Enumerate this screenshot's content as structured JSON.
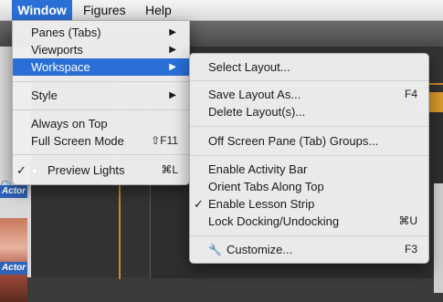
{
  "menubar": {
    "items": [
      {
        "label": "Window"
      },
      {
        "label": "Figures"
      },
      {
        "label": "Help"
      }
    ]
  },
  "background": {
    "actor_label_1": "Actor",
    "actor_label_2": "Actor",
    "accent_color": "#d99a2b"
  },
  "window_menu": {
    "items": [
      {
        "label": "Panes (Tabs)",
        "submenu": true
      },
      {
        "label": "Viewports",
        "submenu": true
      },
      {
        "label": "Workspace",
        "submenu": true,
        "highlighted": true
      },
      {
        "label": "Style",
        "submenu": true
      },
      {
        "label": "Always on Top"
      },
      {
        "label": "Full Screen Mode",
        "shortcut": "⇧F11"
      },
      {
        "label": "Preview Lights",
        "shortcut": "⌘L",
        "checked": true,
        "icon": "light-bulb-icon"
      }
    ]
  },
  "workspace_menu": {
    "items": [
      {
        "label": "Select Layout..."
      },
      {
        "label": "Save Layout As...",
        "shortcut": "F4"
      },
      {
        "label": "Delete Layout(s)..."
      },
      {
        "label": "Off Screen Pane (Tab) Groups..."
      },
      {
        "label": "Enable Activity Bar"
      },
      {
        "label": "Orient Tabs Along Top"
      },
      {
        "label": "Enable Lesson Strip",
        "checked": true
      },
      {
        "label": "Lock Docking/Undocking",
        "shortcut": "⌘U"
      },
      {
        "label": "Customize...",
        "shortcut": "F3",
        "icon": "wrench-icon"
      }
    ]
  },
  "glyphs": {
    "submenu_arrow": "▶",
    "check": "✓"
  },
  "colors": {
    "highlight": "#2a6fd6",
    "menu_bg": "#eeeeee"
  }
}
